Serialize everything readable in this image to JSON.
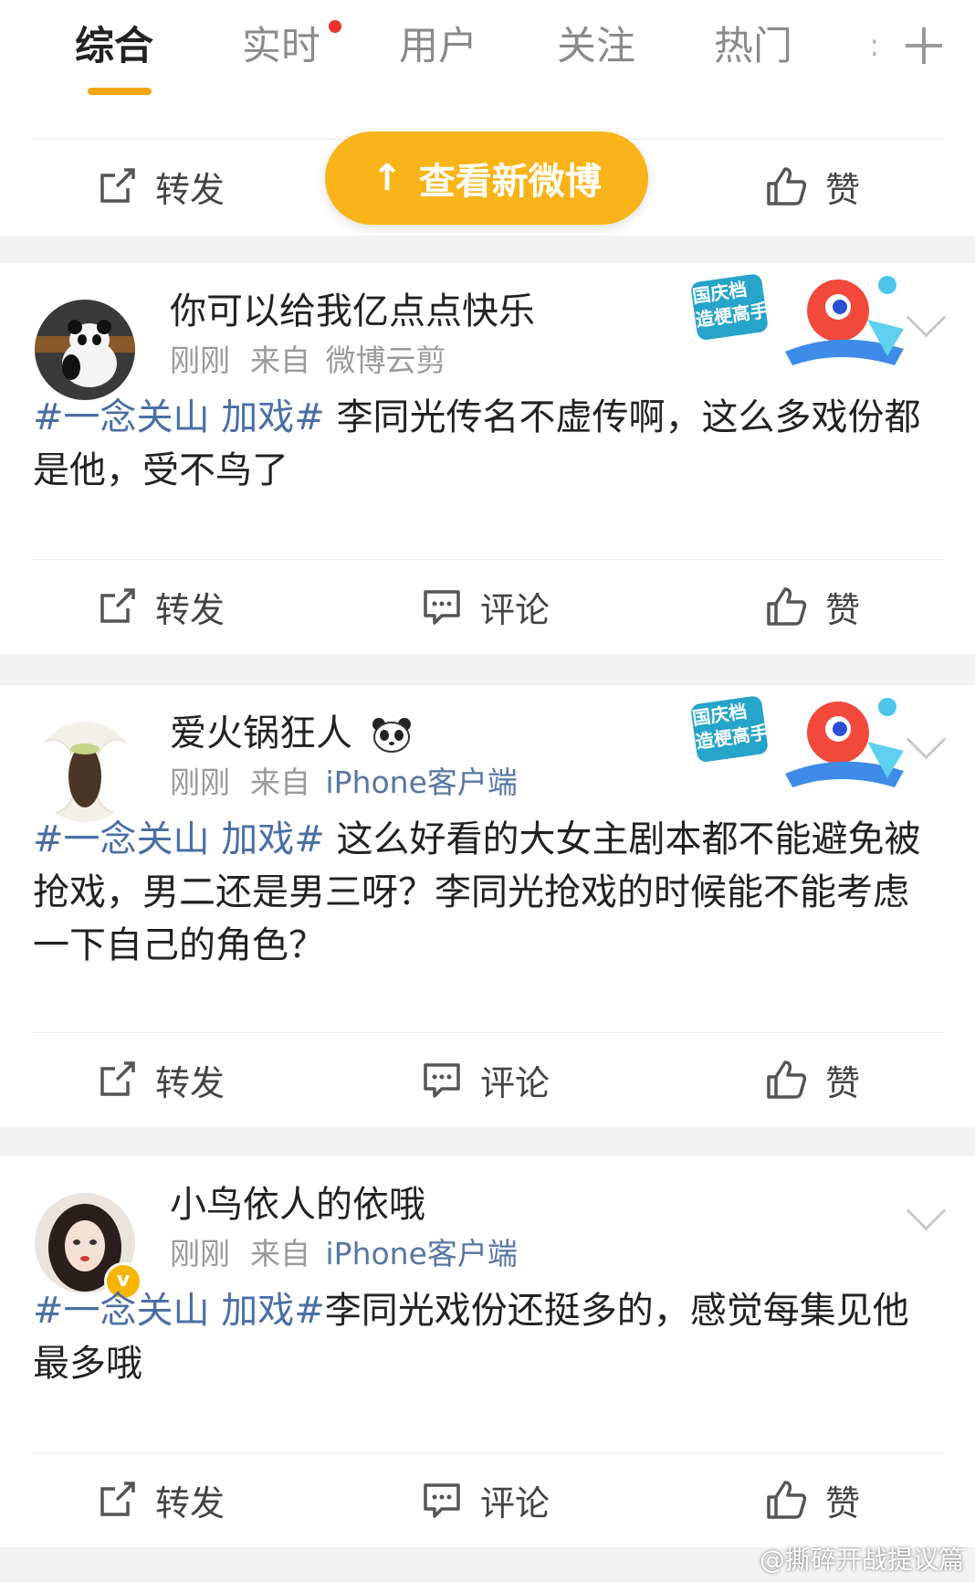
{
  "tabs": {
    "items": [
      "综合",
      "实时",
      "用户",
      "关注",
      "热门"
    ],
    "overflow": ":"
  },
  "new_posts_button": "查看新微博",
  "actions": {
    "repost": "转发",
    "comment": "评论",
    "like": "赞"
  },
  "badge": {
    "line1": "国庆档",
    "line2": "造梗高手"
  },
  "posts": [
    {
      "username": "你可以给我亿点点快乐",
      "time": "刚刚",
      "source_prefix": "来自",
      "source": "微博云剪",
      "topic": "#一念关山 加戏#",
      "text": " 李同光传名不虚传啊，这么多戏份都是他，受不鸟了"
    },
    {
      "username": "爱火锅狂人",
      "time": "刚刚",
      "source_prefix": "来自",
      "source": "iPhone客户端",
      "topic": "#一念关山 加戏#",
      "text": " 这么好看的大女主剧本都不能避免被抢戏，男二还是男三呀？李同光抢戏的时候能不能考虑一下自己的角色？"
    },
    {
      "username": "小鸟依人的依哦",
      "time": "刚刚",
      "source_prefix": "来自",
      "source": "iPhone客户端",
      "topic": "#一念关山 加戏#",
      "text": "李同光戏份还挺多的，感觉每集见他最多哦"
    }
  ],
  "watermark": "@撕碎开战提议篇",
  "colors": {
    "accent": "#f7a612",
    "topic_link": "#4a6fa5",
    "pill": "#f8b418"
  }
}
